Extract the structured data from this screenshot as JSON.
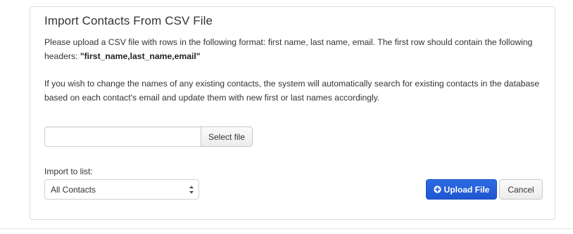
{
  "panel": {
    "title": "Import Contacts From CSV File",
    "instructions_text": "Please upload a CSV file with rows in the following format: first name, last name, email. The first row should contain the following headers: ",
    "headers_example": "\"first_name,last_name,email\"",
    "update_note": "If you wish to change the names of any existing contacts, the system will automatically search for existing contacts in the database based on each contact's email and update them with new first or last names accordingly."
  },
  "file_picker": {
    "value": "",
    "button_label": "Select file"
  },
  "import_list": {
    "label": "Import to list:",
    "selected": "All Contacts"
  },
  "actions": {
    "upload_label": "Upload File",
    "upload_icon": "plus-circle-icon",
    "cancel_label": "Cancel"
  },
  "colors": {
    "primary": "#1e56cf",
    "border": "#dcdcdc",
    "text": "#333333"
  }
}
